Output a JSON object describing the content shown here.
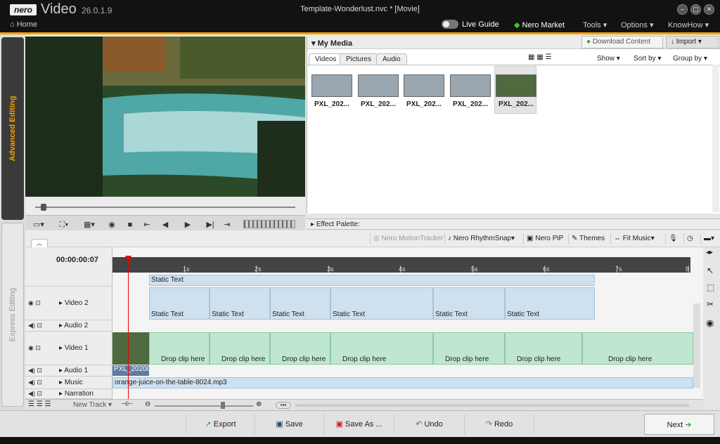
{
  "app": {
    "logo": "nero",
    "name": "Video",
    "version": "26.0.1.9",
    "document_title": "Template-Wonderlust.nvc * [Movie]",
    "home": "Home"
  },
  "menu": {
    "live_guide": "Live Guide",
    "nero_market": "Nero Market",
    "tools": "Tools",
    "options": "Options",
    "knowhow": "KnowHow"
  },
  "sidetabs": {
    "advanced": "Advanced Editing",
    "express": "Express Editing"
  },
  "media": {
    "title": "My Media",
    "download": "Download Content",
    "import": "Import",
    "tabs": [
      "Videos",
      "Pictures",
      "Audio"
    ],
    "show": "Show",
    "sortby": "Sort by",
    "groupby": "Group by",
    "items": [
      "PXL_202...",
      "PXL_202...",
      "PXL_202...",
      "PXL_202...",
      "PXL_202..."
    ]
  },
  "effect_palette": "Effect Palette:",
  "toolbar": {
    "motion": "Nero MotionTracker",
    "rhythm": "Nero RhythmSnap",
    "pip": "Nero PiP",
    "themes": "Themes",
    "fitmusic": "Fit Music"
  },
  "timeline": {
    "timecode": "00:00:00:07",
    "ruler": [
      "1s",
      "2s",
      "3s",
      "4s",
      "5s",
      "6s",
      "7s",
      "8"
    ],
    "tracks": [
      "Video 2",
      "Audio 2",
      "Video 1",
      "Audio 1",
      "Music",
      "Narration"
    ],
    "static_text": "Static Text",
    "drop": "Drop clip here",
    "fx": "fx",
    "clip_label": "PXL_20200",
    "music_file": "orange-juice-on-the-table-8024.mp3",
    "new_track": "New Track"
  },
  "bottom": {
    "export": "Export",
    "save": "Save",
    "saveas": "Save As ...",
    "undo": "Undo",
    "redo": "Redo",
    "next": "Next"
  }
}
